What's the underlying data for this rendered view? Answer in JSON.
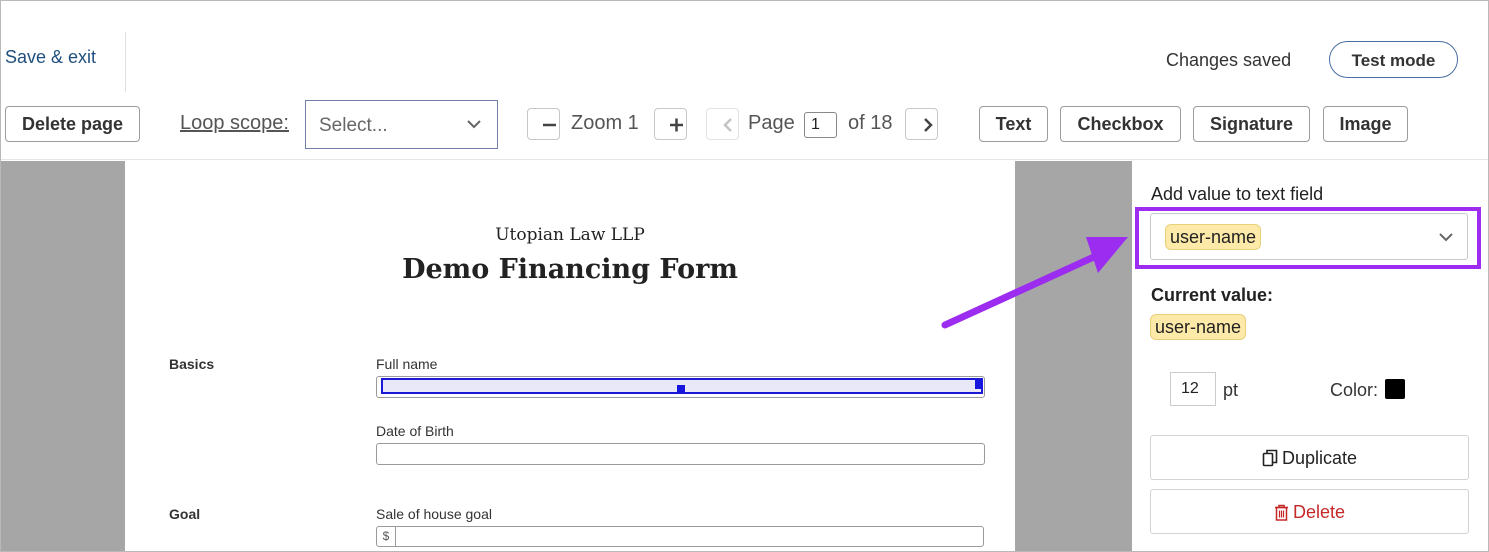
{
  "header": {
    "save_exit": "Save & exit",
    "status": "Changes saved",
    "test_mode": "Test mode"
  },
  "toolbar": {
    "delete_page": "Delete page",
    "loop_scope_label": "Loop scope:",
    "loop_scope_placeholder": "Select...",
    "zoom_label": "Zoom 1",
    "page_label": "Page",
    "page_value": "1",
    "page_total": "of 18",
    "field_buttons": {
      "text": "Text",
      "checkbox": "Checkbox",
      "signature": "Signature",
      "image": "Image"
    }
  },
  "document": {
    "firm": "Utopian Law LLP",
    "title": "Demo Financing Form",
    "sections": {
      "basics": "Basics",
      "goal": "Goal"
    },
    "fields": {
      "full_name": "Full name",
      "dob": "Date of Birth",
      "sale_goal": "Sale of house goal",
      "currency_symbol": "$"
    }
  },
  "side_panel": {
    "add_value_label": "Add value to text field",
    "selected_value": "user-name",
    "current_value_label": "Current value:",
    "current_value": "user-name",
    "font_size": "12",
    "font_unit": "pt",
    "color_label": "Color:",
    "color_value": "#000000",
    "duplicate": "Duplicate",
    "delete": "Delete"
  },
  "colors": {
    "highlight": "#9b2cf0",
    "selection": "#1a1ad6",
    "pill": "#fde9a8",
    "delete": "#c62828",
    "link": "#1f4f7d"
  }
}
